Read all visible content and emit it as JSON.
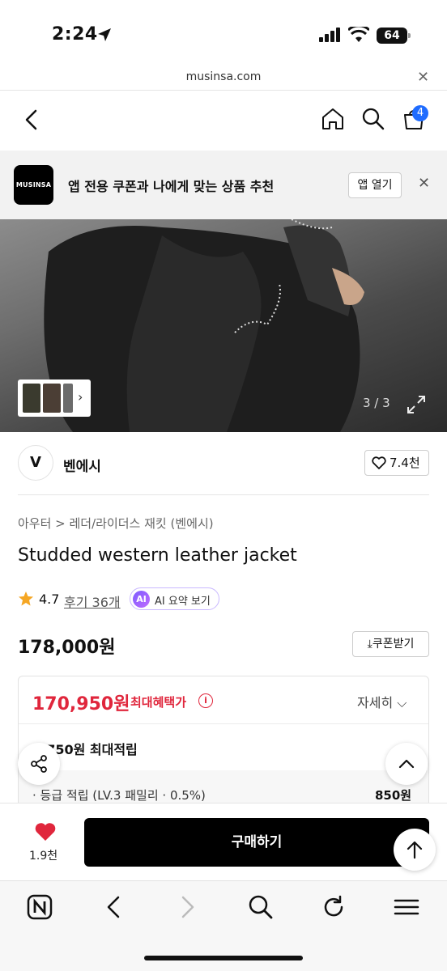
{
  "status_bar": {
    "time": "2:24",
    "battery": "64"
  },
  "browser": {
    "url": "musinsa.com"
  },
  "nav": {
    "cart_count": "4"
  },
  "app_banner": {
    "logo": "MUSINSA",
    "text": "앱 전용 쿠폰과 나에게 맞는 상품 추천",
    "open_button": "앱 열기"
  },
  "gallery": {
    "counter": "3 / 3"
  },
  "brand": {
    "logo_letter": "V",
    "name": "벤에시",
    "likes": "7.4천"
  },
  "product": {
    "breadcrumb": "아우터 > 레더/라이더스 재킷 (벤에시)",
    "title": "Studded western leather jacket",
    "rating": "4.7",
    "reviews": "후기 36개",
    "ai_summary": "AI 요약 보기",
    "price": "178,000원",
    "coupon_button": "쿠폰받기"
  },
  "benefit": {
    "price": "170,950원",
    "label": "최대혜택가",
    "detail": "자세히",
    "points": "8,750원 최대적립",
    "grade_text": "· 등급 적립 (LV.3 패밀리 · 0.5%)",
    "grade_amount": "850원"
  },
  "purchase": {
    "like_count": "1.9천",
    "buy_label": "구매하기"
  },
  "colors": {
    "accent_red": "#e0263c",
    "badge_blue": "#1f6cff",
    "star": "#f5a623"
  }
}
